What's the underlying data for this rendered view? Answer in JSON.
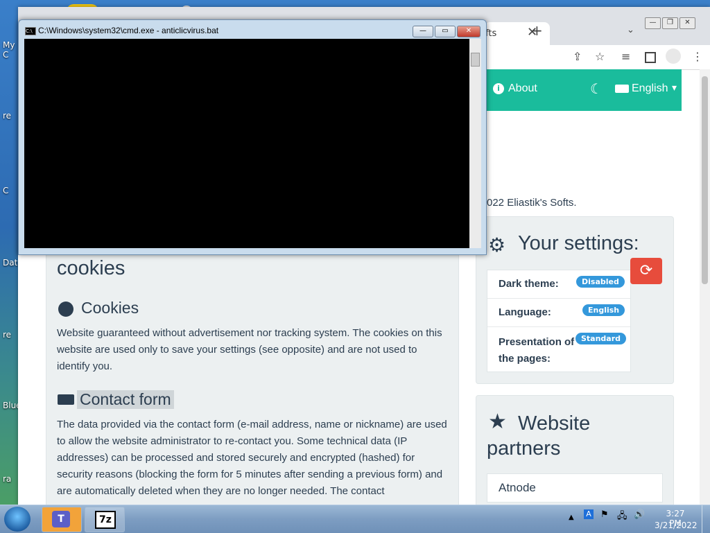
{
  "desktop": {
    "icons": [
      "My C",
      "re",
      "Data",
      "re",
      "Blue",
      "ra",
      "C",
      "C"
    ]
  },
  "browser": {
    "tab_title": "fts",
    "tab_close": "✕",
    "new_tab": "+",
    "tab_chevron": "⌄",
    "win_min": "—",
    "win_max": "❐",
    "win_close": "✕",
    "toolbar_icons": [
      "share-icon",
      "star-icon",
      "reading-list-icon",
      "sidebar-icon",
      "profile-icon",
      "menu-icon"
    ]
  },
  "navbar": {
    "about_label": "About",
    "language_label": "English",
    "info_icon": "i",
    "moon_icon": "☾",
    "caret": "▾"
  },
  "page": {
    "copyright": "022 Eliastik's Softs.",
    "privacy_heading_part": "cookies",
    "cookies_heading": "Cookies",
    "cookies_text": "Website guaranteed without advertisement nor tracking system. The cookies on this website are used only to save your settings (see opposite) and are not used to identify you.",
    "contact_heading": "Contact form",
    "contact_text": "The data provided via the contact form (e-mail address, name or nickname) are used to allow the website administrator to re-contact you. Some technical data (IP addresses) can be processed and stored securely and encrypted (hashed) for security reasons (blocking the form for 5 minutes after sending a previous form) and are automatically deleted when they are no longer needed. The contact"
  },
  "settings": {
    "title": "Your settings:",
    "rows": [
      {
        "label": "Dark theme:",
        "badge": "Disabled"
      },
      {
        "label": "Language:",
        "badge": "English"
      },
      {
        "label": "Presentation of the pages:",
        "badge": "Standard"
      }
    ],
    "reset_icon": "⟳"
  },
  "partners": {
    "title": "Website partners",
    "items": [
      "Atnode"
    ]
  },
  "cmd": {
    "title": "C:\\Windows\\system32\\cmd.exe - anticlicvirus.bat",
    "icon_text": "C:\\",
    "btn_min": "—",
    "btn_max": "▭",
    "btn_close": "✕"
  },
  "taskbar": {
    "clock_time": "3:27 PM",
    "clock_date": "3/21/2022",
    "app_7z": "7z",
    "tray_expand": "▲"
  }
}
